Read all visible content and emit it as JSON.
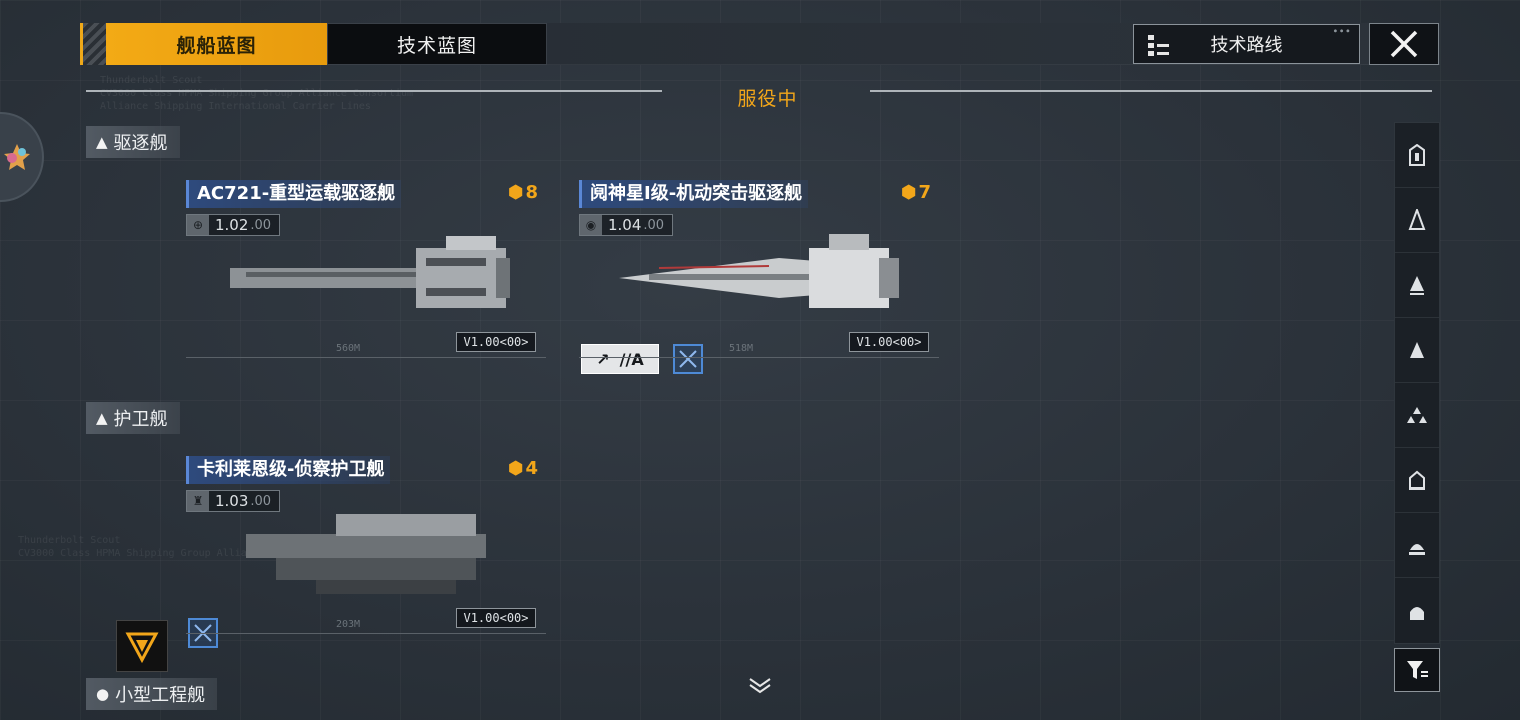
{
  "tabs": [
    {
      "label": "舰船蓝图",
      "active": true
    },
    {
      "label": "技术蓝图",
      "active": false
    }
  ],
  "header": {
    "tech_route_label": "技术路线",
    "section_title": "服役中"
  },
  "categories": [
    {
      "label": "驱逐舰"
    },
    {
      "label": "护卫舰"
    },
    {
      "label": "小型工程舰"
    }
  ],
  "ships": [
    {
      "name": "AC721-重型运载驱逐舰",
      "cost": "8",
      "version": "1.02",
      "version_sub": ".00",
      "length": "560M",
      "blueprint_version": "V1.00<00>"
    },
    {
      "name": "阋神星Ⅰ级-机动突击驱逐舰",
      "cost": "7",
      "version": "1.04",
      "version_sub": ".00",
      "length": "518M",
      "blueprint_version": "V1.00<00>",
      "module_badge": "//A"
    },
    {
      "name": "卡利莱恩级-侦察护卫舰",
      "cost": "4",
      "version": "1.03",
      "version_sub": ".00",
      "length": "203M",
      "blueprint_version": "V1.00<00>"
    }
  ],
  "colors": {
    "accent": "#f2a61a",
    "tab_active": "#f3aa15",
    "blue_tag": "#2e4a7d"
  },
  "icons": [
    "close-icon",
    "tech-route-icon",
    "filter-icon",
    "chevron-down-icon"
  ]
}
